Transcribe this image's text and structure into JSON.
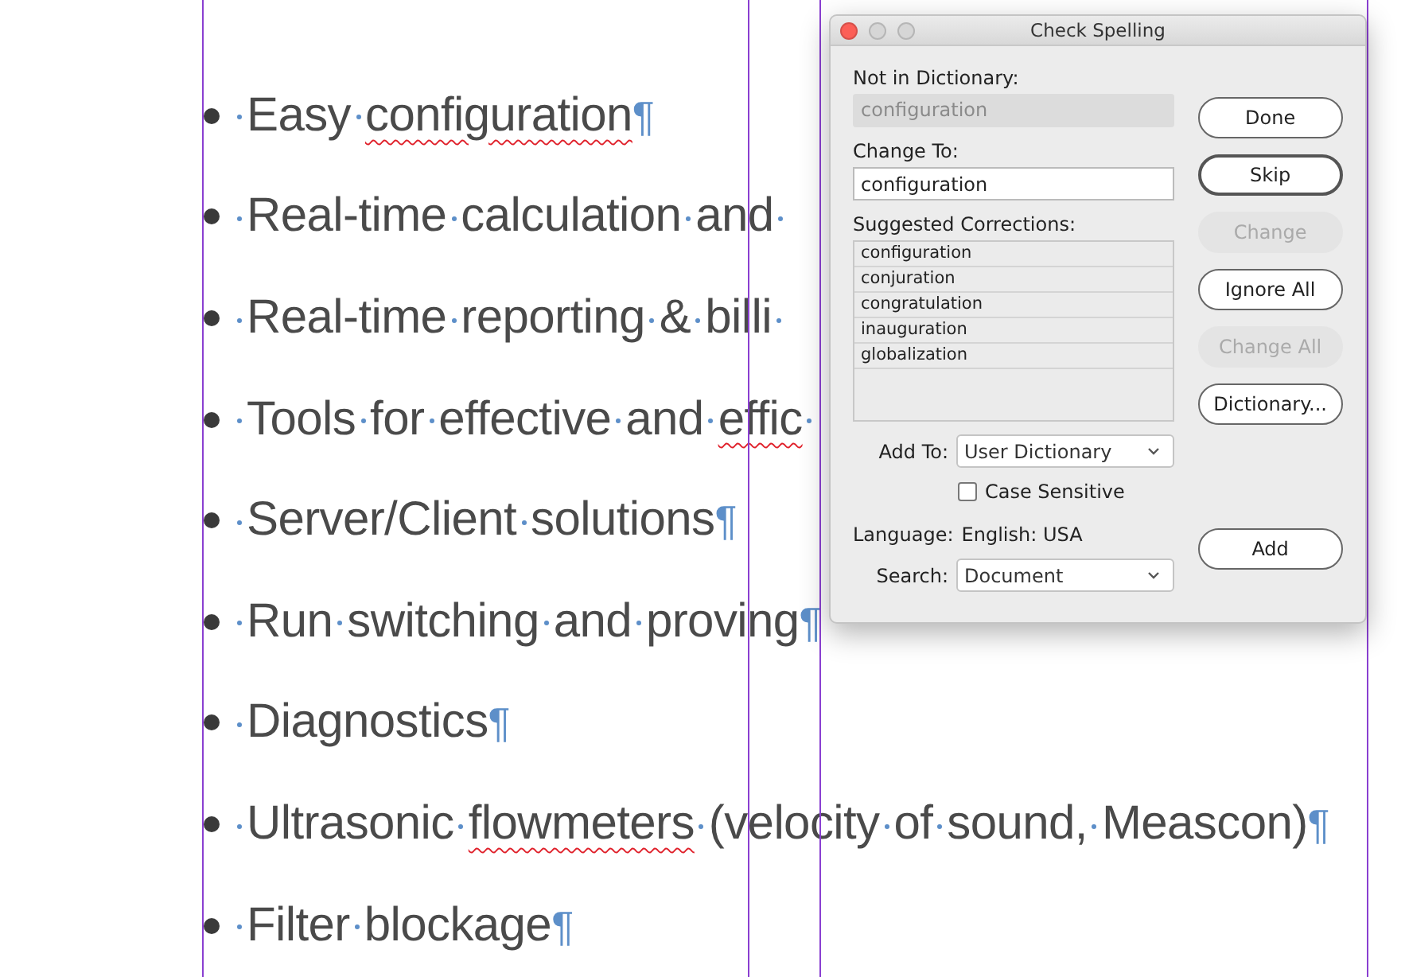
{
  "document": {
    "items": [
      {
        "words": [
          {
            "text": "Easy",
            "misspelled": false
          },
          {
            "text": "configuration",
            "misspelled": true
          }
        ],
        "end_mark": "¶"
      },
      {
        "words": [
          {
            "text": "Real-time",
            "misspelled": false
          },
          {
            "text": "calculation",
            "misspelled": false
          },
          {
            "text": "and",
            "misspelled": false
          }
        ]
      },
      {
        "words": [
          {
            "text": "Real-time",
            "misspelled": false
          },
          {
            "text": "reporting",
            "misspelled": false
          },
          {
            "text": "&",
            "misspelled": false
          },
          {
            "text": "billi",
            "misspelled": false
          }
        ]
      },
      {
        "words": [
          {
            "text": "Tools",
            "misspelled": false
          },
          {
            "text": "for",
            "misspelled": false
          },
          {
            "text": "effective",
            "misspelled": false
          },
          {
            "text": "and",
            "misspelled": false
          },
          {
            "text": "effic",
            "misspelled": true
          }
        ]
      },
      {
        "words": [
          {
            "text": "Server/Client",
            "misspelled": false
          },
          {
            "text": "solutions",
            "misspelled": false
          }
        ],
        "end_mark": "¶"
      },
      {
        "words": [
          {
            "text": "Run",
            "misspelled": false
          },
          {
            "text": "switching",
            "misspelled": false
          },
          {
            "text": "and",
            "misspelled": false
          },
          {
            "text": "proving",
            "misspelled": false
          }
        ],
        "end_mark": "¶"
      },
      {
        "words": [
          {
            "text": "Diagnostics",
            "misspelled": false
          }
        ],
        "end_mark": "¶"
      },
      {
        "words": [
          {
            "text": "Ultrasonic",
            "misspelled": false
          },
          {
            "text": "flowmeters",
            "misspelled": true
          },
          {
            "text": "(velocity",
            "misspelled": false
          },
          {
            "text": "of",
            "misspelled": false
          },
          {
            "text": "sound,",
            "misspelled": false
          },
          {
            "text": "Meascon)",
            "misspelled": false
          }
        ],
        "end_mark": "¶"
      },
      {
        "words": [
          {
            "text": "Filter",
            "misspelled": false
          },
          {
            "text": "blockage",
            "misspelled": false
          }
        ],
        "end_mark": "¶"
      }
    ]
  },
  "dialog": {
    "title": "Check Spelling",
    "not_in_dictionary": {
      "label": "Not in Dictionary:",
      "value": "configuration"
    },
    "change_to": {
      "label": "Change To:",
      "value": "configuration"
    },
    "suggestions": {
      "label": "Suggested Corrections:",
      "items": [
        "configuration",
        "conjuration",
        "congratulation",
        "inauguration",
        "globalization"
      ]
    },
    "add_to": {
      "label": "Add To:",
      "value": "User Dictionary"
    },
    "case_sensitive": {
      "label": "Case Sensitive",
      "checked": false
    },
    "language": {
      "label": "Language:",
      "value": "English: USA"
    },
    "search": {
      "label": "Search:",
      "value": "Document"
    },
    "buttons": [
      {
        "label": "Done",
        "disabled": false,
        "default": false
      },
      {
        "label": "Skip",
        "disabled": false,
        "default": true
      },
      {
        "label": "Change",
        "disabled": true,
        "default": false
      },
      {
        "label": "Ignore All",
        "disabled": false,
        "default": false
      },
      {
        "label": "Change All",
        "disabled": true,
        "default": false
      },
      {
        "label": "Dictionary...",
        "disabled": false,
        "default": false
      }
    ],
    "add_button": {
      "label": "Add",
      "disabled": false,
      "default": false
    }
  }
}
